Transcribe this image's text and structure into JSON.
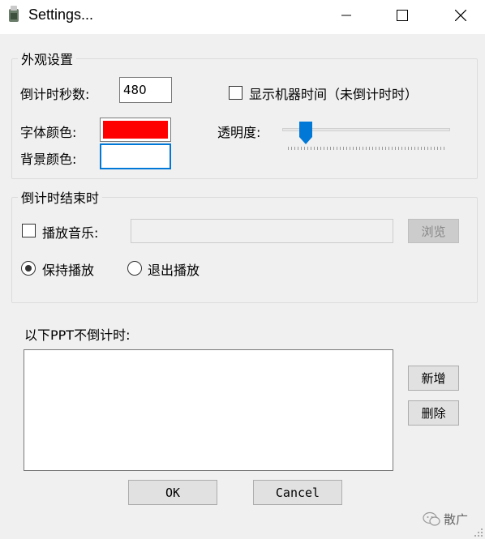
{
  "window": {
    "title": "Settings...",
    "icons": {
      "app": "app-icon",
      "minimize": "minimize-icon",
      "maximize": "maximize-icon",
      "close": "close-icon"
    }
  },
  "appearance": {
    "group_label": "外观设置",
    "countdown_label": "倒计时秒数:",
    "countdown_value": "480",
    "show_time_label": "显示机器时间（未倒计时时）",
    "show_time_checked": false,
    "font_color_label": "字体颜色:",
    "font_color": "#ff0000",
    "bg_color_label": "背景颜色:",
    "bg_color": "#ffffff",
    "transparency_label": "透明度:",
    "transparency_fraction": 0.1
  },
  "end_action": {
    "group_label": "倒计时结束时",
    "play_music_label": "播放音乐:",
    "play_music_checked": false,
    "music_path": "",
    "browse_label": "浏览",
    "radio_keep_label": "保持播放",
    "radio_exit_label": "退出播放",
    "selected": "keep"
  },
  "exclusions": {
    "label": "以下PPT不倒计时:",
    "add_label": "新增",
    "delete_label": "删除"
  },
  "footer": {
    "ok_label": "OK",
    "cancel_label": "Cancel",
    "watermark_text": "散广"
  },
  "colors": {
    "accent": "#0078d7",
    "red": "#ff0000"
  }
}
